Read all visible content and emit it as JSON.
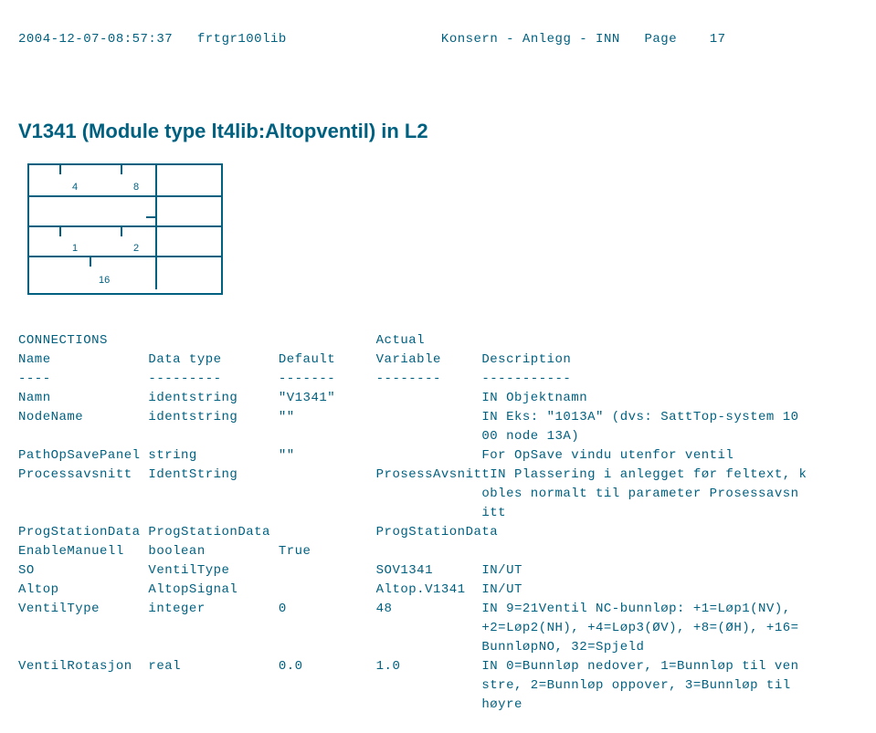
{
  "header": {
    "timestamp": "2004-12-07-08:57:37",
    "lib": "frtgr100lib",
    "doc_title": "Konsern - Anlegg - INN",
    "page_label": "Page",
    "page_no": "17"
  },
  "section_title": "V1341 (Module type lt4lib:Altopventil) in L2",
  "diagram": {
    "n4": "4",
    "n8": "8",
    "n1": "1",
    "n2": "2",
    "n16": "16"
  },
  "connections": {
    "heading": "CONNECTIONS",
    "col_headers": {
      "name": "Name",
      "datatype": "Data type",
      "default": "Default",
      "actual_var": "Actual\nVariable",
      "description": "Description"
    },
    "rows": [
      {
        "name": "Namn",
        "datatype": "identstring",
        "default": "\"V1341\"",
        "actual": "",
        "desc": "IN Objektnamn"
      },
      {
        "name": "NodeName",
        "datatype": "identstring",
        "default": "\"\"",
        "actual": "",
        "desc": "IN Eks: \"1013A\" (dvs: SattTop-system 10\n00 node 13A)"
      },
      {
        "name": "PathOpSavePanel",
        "datatype": "string",
        "default": "\"\"",
        "actual": "",
        "desc": "For OpSave vindu utenfor ventil"
      },
      {
        "name": "Processavsnitt",
        "datatype": "IdentString",
        "default": "",
        "actual": "ProsessAvsnitt",
        "desc": "IN Plassering i anlegget før feltext, k\nobles normalt til parameter Prosessavsn\nitt"
      },
      {
        "name": "ProgStationData",
        "datatype": "ProgStationData",
        "default": "",
        "actual": "ProgStationData",
        "desc": ""
      },
      {
        "name": "EnableManuell",
        "datatype": "boolean",
        "default": "True",
        "actual": "",
        "desc": ""
      },
      {
        "name": "SO",
        "datatype": "VentilType",
        "default": "",
        "actual": "SOV1341",
        "desc": "IN/UT"
      },
      {
        "name": "Altop",
        "datatype": "AltopSignal",
        "default": "",
        "actual": "Altop.V1341",
        "desc": "IN/UT"
      },
      {
        "name": "VentilType",
        "datatype": "integer",
        "default": "0",
        "actual": "48",
        "desc": "IN 9=21Ventil NC-bunnløp: +1=Løp1(NV),\n+2=Løp2(NH), +4=Løp3(ØV), +8=(ØH), +16=\nBunnløpNO, 32=Spjeld"
      },
      {
        "name": "VentilRotasjon",
        "datatype": "real",
        "default": "0.0",
        "actual": "1.0",
        "desc": "IN 0=Bunnløp nedover, 1=Bunnløp til ven\nstre, 2=Bunnløp oppover, 3=Bunnløp til\nhøyre"
      }
    ],
    "dashes": {
      "name": "----",
      "datatype": "---------",
      "default": "-------",
      "actual": "--------",
      "desc": "-----------"
    }
  }
}
